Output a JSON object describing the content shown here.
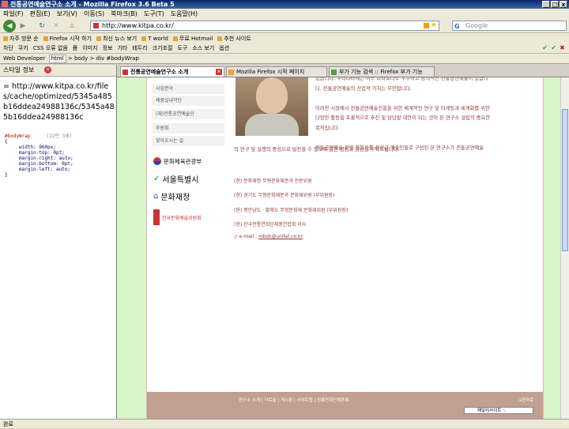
{
  "window": {
    "title": "전통공연예술연구소 소개 - Mozilla Firefox 3.6 Beta 5"
  },
  "menu": [
    "파일(F)",
    "편집(E)",
    "보기(V)",
    "이동(S)",
    "북마크(B)",
    "도구(T)",
    "도움말(H)"
  ],
  "nav": {
    "url": "http://www.kitpa.co.kr/",
    "search_placeholder": "Google",
    "search_engine": "G"
  },
  "bookmarks": [
    "자주 방문 순",
    "Firefox 시작 하기",
    "최신 뉴스 보기",
    "T world",
    "무료 Hotmail",
    "추천 사이트"
  ],
  "addons": [
    "차단",
    "쿠키",
    "CSS 오류 없음",
    "폼",
    "이미지",
    "정보",
    "기타",
    "테두리",
    "크기조절",
    "도구",
    "소스 보기",
    "옵션"
  ],
  "webdev": {
    "label": "Web Developer",
    "crumbs": [
      "html",
      "body",
      "div #bodyWrap"
    ]
  },
  "sidebar": {
    "header": "스타일 정보",
    "url": "= http://www.kitpa.co.kr/files/cache/optimized/5345a485b16ddea24988136c/5345a485b16ddea24988136c",
    "selector": "#bodyWrap",
    "lines": "(22번 3세)",
    "props": [
      "width: 960px;",
      "margin-top: 0pt;",
      "margin-right: auto;",
      "margin-bottom: 0pt;",
      "margin-left: auto;",
      "}"
    ]
  },
  "tabs": [
    {
      "label": "전통공연예술연구소 소개",
      "active": true
    },
    {
      "label": "Mozilla Firefox 시작 페이지",
      "active": false
    },
    {
      "label": "부가 기능 검색 :: Firefox 부가 기능",
      "active": false
    }
  ],
  "page": {
    "menu": [
      "사업분야",
      "제품실내악단",
      "(재)전통공연예술단",
      "후원회",
      "찾아오시는 길"
    ],
    "logos": [
      "문화체육관광부",
      "서울특별시",
      "문화재청",
      "한국문화예술위원회"
    ],
    "para1": [
      "었습니다. 우리나라에는 어느 나라보다도 우수하고 창의적인 전통공연예술이 있습니",
      "다. 전통공연예술의 산업적 가치는 무한합니다.",
      "",
      "이러한 시점에서 전통공연예술진흥을 위한 체계적인 연구 및 마케팅과 세계화를 위한",
      "다양한 활동을 포괄적으로 추진 및 담당할 대안이 되는 것이 본 연구소 설립의 중요한",
      "목적입니다.",
      "",
      "전통공연예술 관련 전문가를 정상급 예술인들로 구성된 본 연구소가 전통공연예술"
    ],
    "para2": "의 연구 및 실행의 중심으로 발전할 수 있도록 많은 성원과 관심을 부탁드립니다.",
    "history": [
      "(현) 문화재청 무형문화재분과 전문위원",
      "(현) 경기도 무형문화재분과 문화재위원 (부위원장)",
      "(현) 평안남도 · 황해도 무형문화재 문화재위원 (부위원장)",
      "(현) 한국전통연희단체총연합회 이사"
    ],
    "email_label": "◇ e-mail : ",
    "email": "mbsk@unitel.co.kr",
    "footer_links": "연구소 소개 | 자료실 | 게시판 | 사이트맵 | 전통연희단체등록",
    "footer_count": "1현자료",
    "footer_select": "패밀리사이트 ::"
  },
  "status": "완료"
}
